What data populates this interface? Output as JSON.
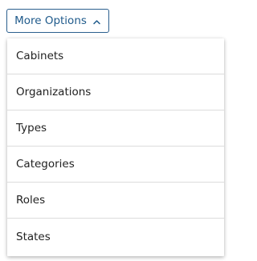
{
  "dropdown": {
    "toggle_label": "More Options",
    "toggle_icon": "chevron-up-icon",
    "accent_color": "#1f5a8b",
    "items": [
      {
        "label": "Cabinets"
      },
      {
        "label": "Organizations"
      },
      {
        "label": "Types"
      },
      {
        "label": "Categories"
      },
      {
        "label": "Roles"
      },
      {
        "label": "States"
      }
    ]
  }
}
